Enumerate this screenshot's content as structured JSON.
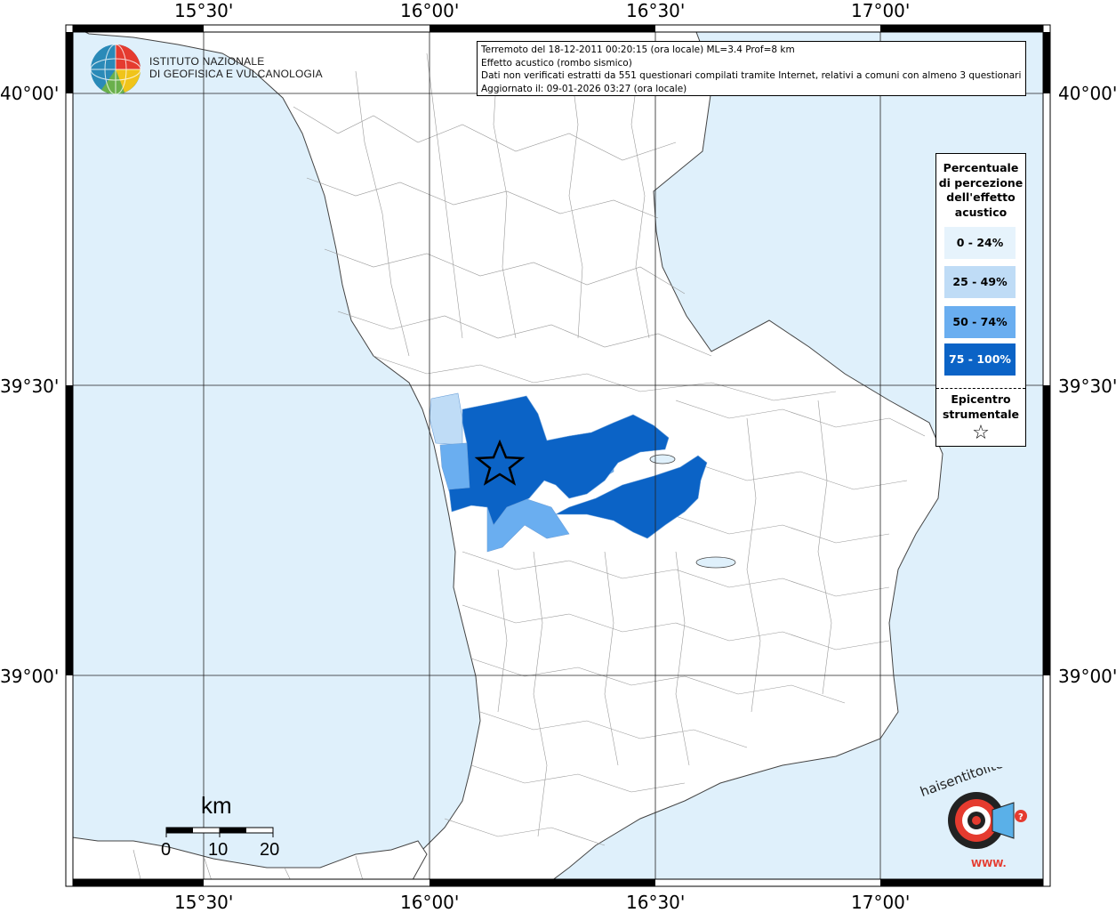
{
  "info": {
    "line1": "Terremoto del 18-12-2011 00:20:15 (ora locale) ML=3.4 Prof=8 km",
    "line2": "Effetto acustico (rombo sismico)",
    "line3": "Dati non verificati estratti da 551 questionari compilati tramite Internet, relativi a comuni con almeno 3 questionari.",
    "line4": "Aggiornato il: 09-01-2026 03:27 (ora locale)"
  },
  "axes": {
    "lon_labels": [
      "15°30'",
      "16°00'",
      "16°30'",
      "17°00'"
    ],
    "lat_labels": [
      "40°00'",
      "39°30'",
      "39°00'"
    ]
  },
  "legend": {
    "title_lines": [
      "Percentuale",
      "di percezione",
      "dell'effetto",
      "acustico"
    ],
    "classes": [
      {
        "label": "0 - 24%",
        "color": "#e6f3fc"
      },
      {
        "label": "25 - 49%",
        "color": "#bfdcf6"
      },
      {
        "label": "50 - 74%",
        "color": "#6aaef0"
      },
      {
        "label": "75 - 100%",
        "color": "#0b63c6"
      }
    ],
    "epicenter_lines": [
      "Epicentro",
      "strumentale"
    ],
    "epicenter_symbol": "☆"
  },
  "logo_ingv": {
    "line1": "ISTITUTO NAZIONALE",
    "line2": "DI GEOFISICA E VULCANOLOGIA"
  },
  "scale": {
    "unit": "km",
    "ticks": [
      "0",
      "10",
      "20"
    ]
  },
  "hst_logo": {
    "text": "haisentitoilterremoto.it",
    "url": "WWW."
  },
  "colors": {
    "sea": "#dff0fb",
    "land": "#ffffff",
    "border": "#8a8a8a"
  },
  "epicenter": {
    "lon": 16.16,
    "lat": 39.37
  }
}
